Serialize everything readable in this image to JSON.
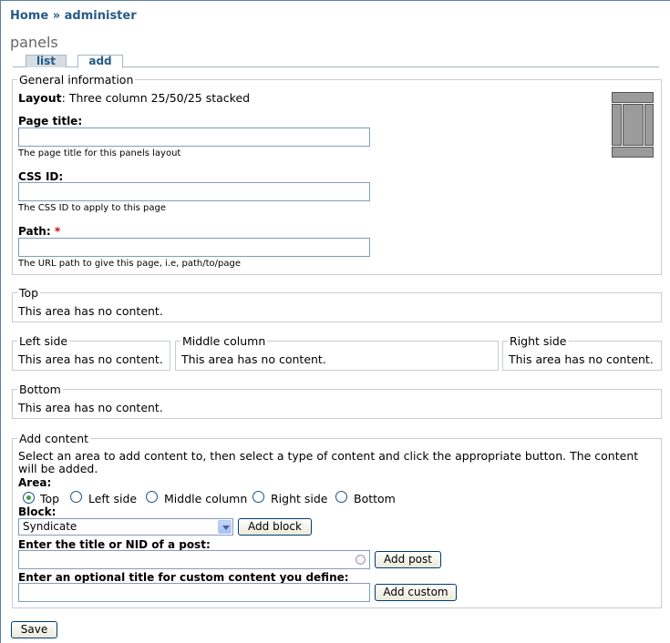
{
  "breadcrumb": {
    "home": "Home",
    "sep": "»",
    "current": "administer"
  },
  "page_title": "panels",
  "tabs": [
    {
      "label": "list"
    },
    {
      "label": "add"
    }
  ],
  "general": {
    "legend": "General information",
    "layout_label": "Layout",
    "layout_value": ": Three column 25/50/25 stacked",
    "layout_icon": "three-column-stacked-layout-icon",
    "page_title_label": "Page title:",
    "page_title_value": "",
    "page_title_desc": "The page title for this panels layout",
    "css_id_label": "CSS ID:",
    "css_id_value": "",
    "css_id_desc": "The CSS ID to apply to this page",
    "path_label": "Path:",
    "path_required": "*",
    "path_value": "",
    "path_desc": "The URL path to give this page, i.e, path/to/page"
  },
  "regions": {
    "top": {
      "legend": "Top",
      "text": "This area has no content."
    },
    "left": {
      "legend": "Left side",
      "text": "This area has no content."
    },
    "middle": {
      "legend": "Middle column",
      "text": "This area has no content."
    },
    "right": {
      "legend": "Right side",
      "text": "This area has no content."
    },
    "bottom": {
      "legend": "Bottom",
      "text": "This area has no content."
    }
  },
  "add_content": {
    "legend": "Add content",
    "instructions": "Select an area to add content to, then select a type of content and click the appropriate button. The content will be added.",
    "area_label": "Area:",
    "areas": [
      {
        "label": "Top",
        "checked": true
      },
      {
        "label": "Left side",
        "checked": false
      },
      {
        "label": "Middle column",
        "checked": false
      },
      {
        "label": "Right side",
        "checked": false
      },
      {
        "label": "Bottom",
        "checked": false
      }
    ],
    "block_label": "Block:",
    "block_selected": "Syndicate",
    "add_block_button": "Add block",
    "post_label": "Enter the title or NID of a post:",
    "post_value": "",
    "add_post_button": "Add post",
    "custom_label": "Enter an optional title for custom content you define:",
    "custom_value": "",
    "add_custom_button": "Add custom"
  },
  "save_button": "Save",
  "colors": {
    "link": "#275a86",
    "required": "#cc0000",
    "radio_checked": "#3c9f3c"
  }
}
